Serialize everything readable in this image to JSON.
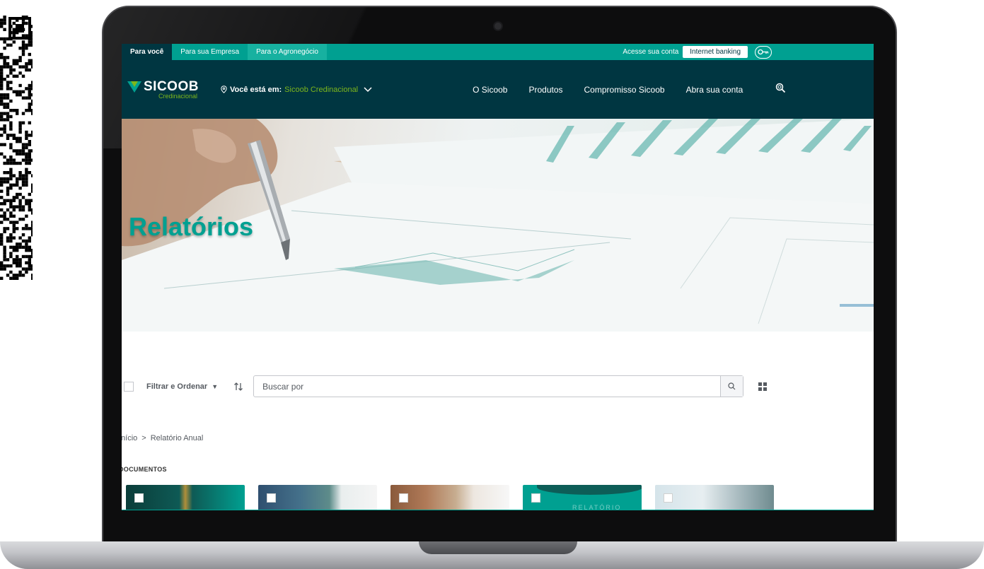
{
  "topbar": {
    "tabs": [
      {
        "label": "Para você",
        "active": true
      },
      {
        "label": "Para sua Empresa",
        "active": false
      },
      {
        "label": "Para o Agronegócio",
        "active": false
      }
    ],
    "access_text": "Acesse sua conta",
    "internet_banking_label": "Internet banking",
    "key_icon": "key-icon"
  },
  "navbar": {
    "logo_text": "SICOOB",
    "logo_sub": "Credinacional",
    "location_label": "Você está em:",
    "location_value": "Sicoob Credinacional",
    "links": [
      {
        "label": "O Sicoob"
      },
      {
        "label": "Produtos"
      },
      {
        "label": "Compromisso Sicoob"
      },
      {
        "label": "Abra sua conta"
      }
    ],
    "search_icon": "search-icon"
  },
  "hero": {
    "title": "Relatórios"
  },
  "toolbar": {
    "filter_label": "Filtrar e Ordenar",
    "search_placeholder": "Buscar por"
  },
  "breadcrumb": {
    "items": [
      "Início",
      "Relatório Anual"
    ]
  },
  "documents": {
    "section_title": "DOCUMENTOS",
    "card4_text": "RELATÓRIO"
  },
  "colors": {
    "brand_teal": "#00a091",
    "brand_dark": "#003641",
    "brand_green": "#7db61c"
  }
}
